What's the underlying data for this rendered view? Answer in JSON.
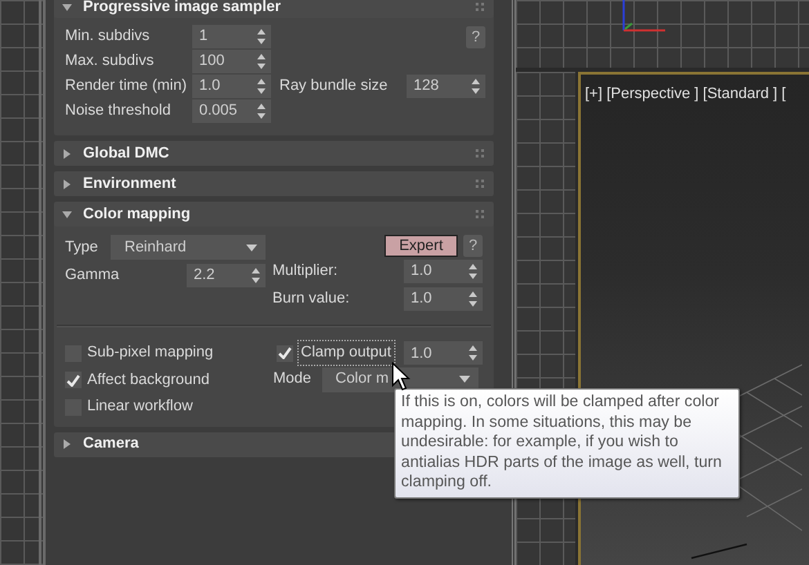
{
  "viewport": {
    "label": "[+] [Perspective ] [Standard ] ["
  },
  "rollouts": [
    {
      "title": "Progressive image sampler",
      "expanded": true,
      "help": "?",
      "rows": [
        {
          "label": "Min. subdivs",
          "value": "1"
        },
        {
          "label": "Max. subdivs",
          "value": "100"
        },
        {
          "label": "Render time (min)",
          "value": "1.0",
          "extra_label": "Ray bundle size",
          "extra_value": "128"
        },
        {
          "label": "Noise threshold",
          "value": "0.005"
        }
      ]
    },
    {
      "title": "Global DMC",
      "expanded": false
    },
    {
      "title": "Environment",
      "expanded": false
    },
    {
      "title": "Color mapping",
      "expanded": true,
      "color_mapping": {
        "type_label": "Type",
        "type_value": "Reinhard",
        "expert_button": "Expert",
        "help": "?",
        "gamma_label": "Gamma",
        "gamma_value": "2.2",
        "multiplier_label": "Multiplier:",
        "multiplier_value": "1.0",
        "burn_label": "Burn value:",
        "burn_value": "1.0",
        "options": [
          {
            "label": "Sub-pixel mapping",
            "checked": false
          },
          {
            "label": "Affect background",
            "checked": true
          },
          {
            "label": "Linear workflow",
            "checked": false
          }
        ],
        "clamp": {
          "label": "Clamp output",
          "checked": true,
          "value": "1.0"
        },
        "mode_label": "Mode",
        "mode_value": "Color m"
      }
    },
    {
      "title": "Camera",
      "expanded": false
    }
  ],
  "tooltip": {
    "text": "If this is on, colors will be clamped after color mapping. In some situations, this may be undesirable: for example, if you wish to antialias HDR parts of the image as well, turn clamping off."
  }
}
